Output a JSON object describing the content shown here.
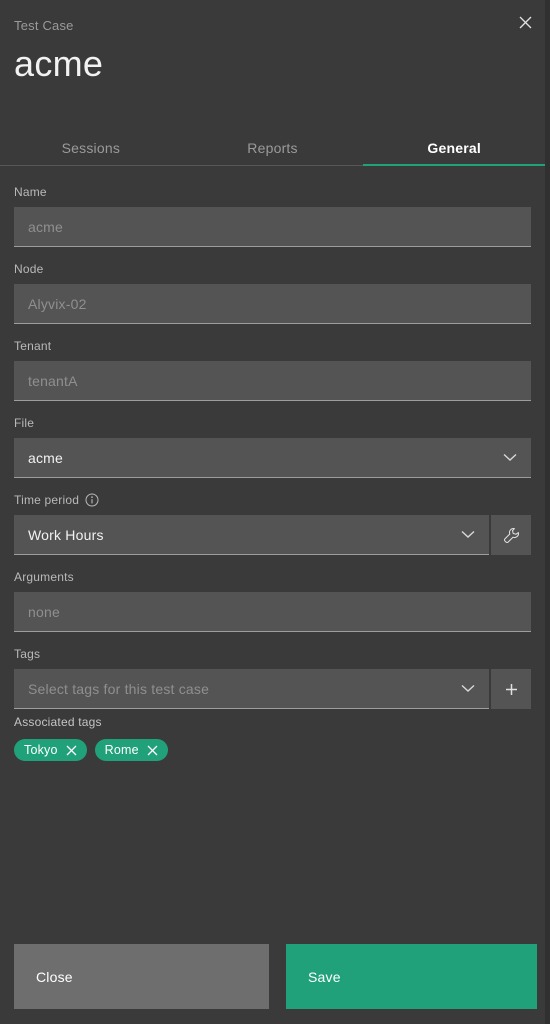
{
  "dialog": {
    "kicker": "Test Case",
    "title": "acme",
    "close_icon": "close-icon"
  },
  "tabs": [
    {
      "label": "Sessions",
      "active": false
    },
    {
      "label": "Reports",
      "active": false
    },
    {
      "label": "General",
      "active": true
    }
  ],
  "form": {
    "name": {
      "label": "Name",
      "value": "acme",
      "placeholder": "acme",
      "disabled": true
    },
    "node": {
      "label": "Node",
      "value": "Alyvix-02",
      "placeholder": "Alyvix-02",
      "disabled": true
    },
    "tenant": {
      "label": "Tenant",
      "value": "tenantA",
      "placeholder": "tenantA",
      "disabled": true
    },
    "file": {
      "label": "File",
      "value": "acme",
      "icon": "chevron-down-icon"
    },
    "time_period": {
      "label": "Time period",
      "info_icon": "info-icon",
      "value": "Work Hours",
      "icon": "chevron-down-icon",
      "side_button_icon": "wrench-icon"
    },
    "arguments": {
      "label": "Arguments",
      "value": "none",
      "placeholder": "none",
      "disabled": true
    },
    "tags": {
      "label": "Tags",
      "placeholder": "Select tags for this test case",
      "icon": "chevron-down-icon",
      "add_button_icon": "plus-icon"
    },
    "associated_tags": {
      "label": "Associated tags",
      "items": [
        {
          "label": "Tokyo",
          "remove_icon": "close-icon"
        },
        {
          "label": "Rome",
          "remove_icon": "close-icon"
        }
      ]
    }
  },
  "footer": {
    "close_label": "Close",
    "save_label": "Save"
  },
  "colors": {
    "background": "#3a3a3a",
    "field": "#545454",
    "accent": "#21a179",
    "muted_text": "#8f8f8f",
    "button_secondary": "#6e6e6e"
  }
}
